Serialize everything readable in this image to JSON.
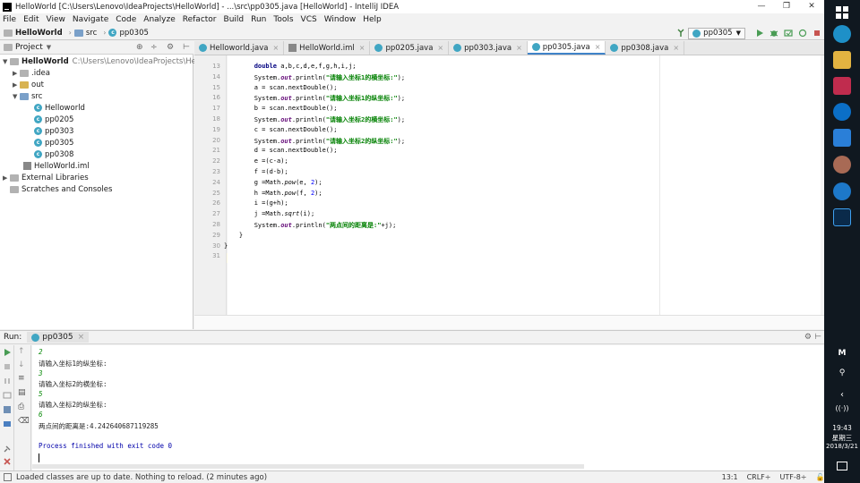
{
  "window": {
    "title": "HelloWorld [C:\\Users\\Lenovo\\IdeaProjects\\HelloWorld] - ...\\src\\pp0305.java [HelloWorld] - IntelliJ IDEA",
    "minimize": "—",
    "maximize": "❐",
    "close": "✕"
  },
  "menu": [
    "File",
    "Edit",
    "View",
    "Navigate",
    "Code",
    "Analyze",
    "Refactor",
    "Build",
    "Run",
    "Tools",
    "VCS",
    "Window",
    "Help"
  ],
  "breadcrumb": {
    "project": "HelloWorld",
    "folder": "src",
    "file": "pp0305"
  },
  "run_config": "pp0305",
  "project_panel": {
    "title": "Project",
    "tree": [
      {
        "label": "HelloWorld",
        "extra": "C:\\Users\\Lenovo\\IdeaProjects\\HelloWorld"
      },
      {
        "label": ".idea"
      },
      {
        "label": "out"
      },
      {
        "label": "src"
      },
      {
        "label": "Helloworld"
      },
      {
        "label": "pp0205"
      },
      {
        "label": "pp0303"
      },
      {
        "label": "pp0305"
      },
      {
        "label": "pp0308"
      },
      {
        "label": "HelloWorld.iml"
      },
      {
        "label": "External Libraries"
      },
      {
        "label": "Scratches and Consoles"
      }
    ]
  },
  "tabs": [
    {
      "label": "Helloworld.java"
    },
    {
      "label": "HelloWorld.iml"
    },
    {
      "label": "pp0205.java"
    },
    {
      "label": "pp0303.java"
    },
    {
      "label": "pp0305.java"
    },
    {
      "label": "pp0308.java"
    }
  ],
  "editor": {
    "line_numbers": [
      "13",
      "14",
      "15",
      "16",
      "17",
      "18",
      "19",
      "20",
      "21",
      "22",
      "23",
      "24",
      "25",
      "26",
      "27",
      "28",
      "29",
      "30",
      "31"
    ],
    "lines": [
      "        double a,b,c,d,e,f,g,h,i,j;",
      "        System.out.println(\"请输入坐标1的横坐标:\");",
      "        a = scan.nextDouble();",
      "        System.out.println(\"请输入坐标1的纵坐标:\");",
      "        b = scan.nextDouble();",
      "        System.out.println(\"请输入坐标2的横坐标:\");",
      "        c = scan.nextDouble();",
      "        System.out.println(\"请输入坐标2的纵坐标:\");",
      "        d = scan.nextDouble();",
      "        e =(c-a);",
      "        f =(d-b);",
      "        g =Math.pow(e, 2);",
      "        h =Math.pow(f, 2);",
      "        i =(g+h);",
      "        j =Math.sqrt(i);",
      "        System.out.println(\"两点间的距离是:\"+j);",
      "    }",
      "}",
      ""
    ]
  },
  "run_panel": {
    "label": "Run:",
    "tab": "pp0305",
    "console": [
      {
        "text": "2",
        "kind": "inp"
      },
      {
        "text": "请输入坐标1的纵坐标:",
        "kind": "out"
      },
      {
        "text": "3",
        "kind": "inp"
      },
      {
        "text": "请输入坐标2的横坐标:",
        "kind": "out"
      },
      {
        "text": "5",
        "kind": "inp"
      },
      {
        "text": "请输入坐标2的纵坐标:",
        "kind": "out"
      },
      {
        "text": "6",
        "kind": "inp"
      },
      {
        "text": "两点间的距离是:4.242640687119285",
        "kind": "out"
      },
      {
        "text": "",
        "kind": "out"
      },
      {
        "text": "Process finished with exit code 0",
        "kind": "gray"
      }
    ]
  },
  "status": {
    "message": "Loaded classes are up to date. Nothing to reload. (2 minutes ago)",
    "position": "13:1",
    "line_sep": "CRLF÷",
    "encoding": "UTF-8÷"
  },
  "taskbar": {
    "time": "19:43",
    "weekday": "星期三",
    "date": "2018/3/21",
    "ime": "M"
  },
  "colors": {
    "accent": "#4083c9",
    "string": "#008000",
    "keyword": "#000080",
    "field": "#660e7a",
    "console_input": "#088a08"
  }
}
